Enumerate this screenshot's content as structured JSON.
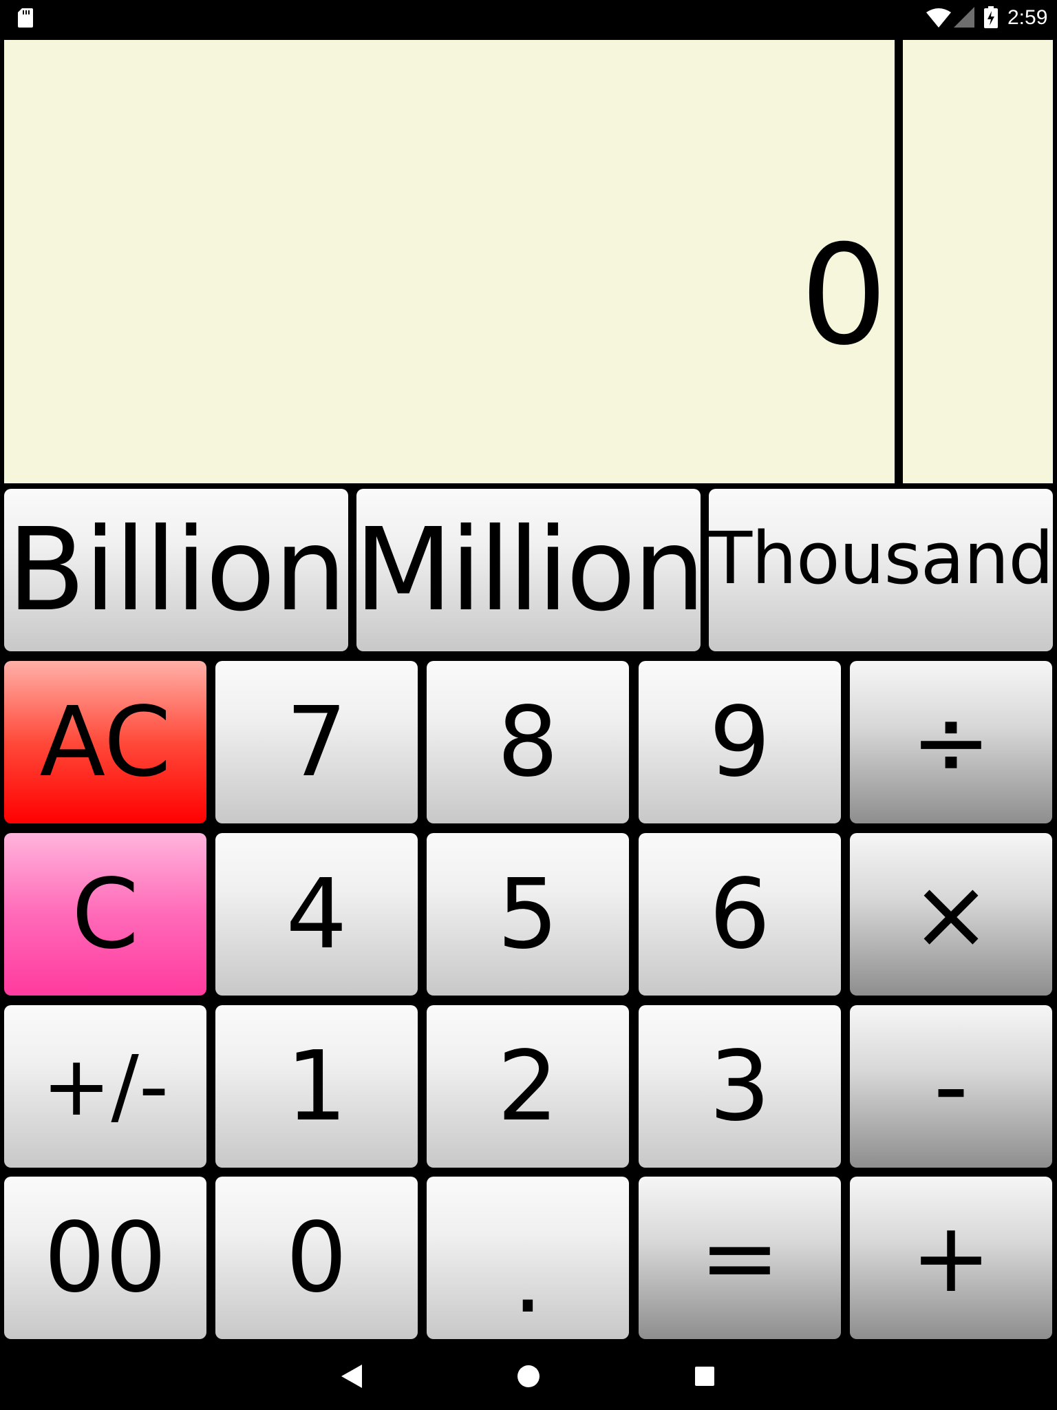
{
  "status_bar": {
    "time": "2:59",
    "icons": [
      "sd-card-icon",
      "wifi-icon",
      "cell-signal-icon",
      "battery-charging-icon"
    ]
  },
  "display": {
    "value": "0",
    "side_value": ""
  },
  "units": [
    {
      "label": "Billion"
    },
    {
      "label": "Million"
    },
    {
      "label": "Thousand"
    }
  ],
  "keys": {
    "ac": "AC",
    "seven": "7",
    "eight": "8",
    "nine": "9",
    "divide": "÷",
    "c": "C",
    "four": "4",
    "five": "5",
    "six": "6",
    "multiply": "×",
    "plus_minus": "+/-",
    "one": "1",
    "two": "2",
    "three": "3",
    "minus": "-",
    "double_zero": "00",
    "zero": "0",
    "dot": ".",
    "equals": "=",
    "plus": "+"
  },
  "nav_bar": {
    "icons": [
      "back-icon",
      "home-icon",
      "recent-apps-icon"
    ]
  },
  "colors": {
    "display_background": "#f5f6dc",
    "ac_key": "#ff0000",
    "c_key": "#ff3a9e"
  }
}
